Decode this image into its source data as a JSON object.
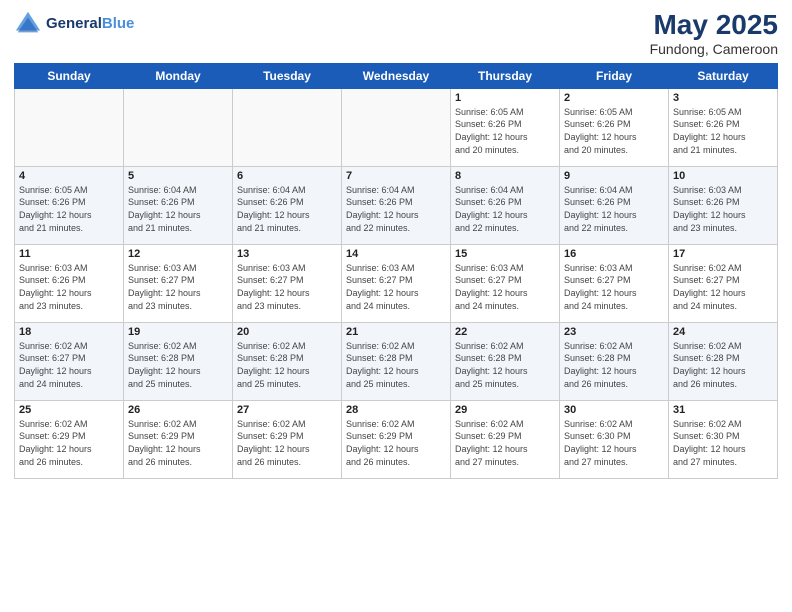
{
  "header": {
    "logo_line1": "General",
    "logo_line2": "Blue",
    "main_title": "May 2025",
    "subtitle": "Fundong, Cameroon"
  },
  "days_of_week": [
    "Sunday",
    "Monday",
    "Tuesday",
    "Wednesday",
    "Thursday",
    "Friday",
    "Saturday"
  ],
  "weeks": [
    [
      {
        "day": "",
        "info": ""
      },
      {
        "day": "",
        "info": ""
      },
      {
        "day": "",
        "info": ""
      },
      {
        "day": "",
        "info": ""
      },
      {
        "day": "1",
        "info": "Sunrise: 6:05 AM\nSunset: 6:26 PM\nDaylight: 12 hours\nand 20 minutes."
      },
      {
        "day": "2",
        "info": "Sunrise: 6:05 AM\nSunset: 6:26 PM\nDaylight: 12 hours\nand 20 minutes."
      },
      {
        "day": "3",
        "info": "Sunrise: 6:05 AM\nSunset: 6:26 PM\nDaylight: 12 hours\nand 21 minutes."
      }
    ],
    [
      {
        "day": "4",
        "info": "Sunrise: 6:05 AM\nSunset: 6:26 PM\nDaylight: 12 hours\nand 21 minutes."
      },
      {
        "day": "5",
        "info": "Sunrise: 6:04 AM\nSunset: 6:26 PM\nDaylight: 12 hours\nand 21 minutes."
      },
      {
        "day": "6",
        "info": "Sunrise: 6:04 AM\nSunset: 6:26 PM\nDaylight: 12 hours\nand 21 minutes."
      },
      {
        "day": "7",
        "info": "Sunrise: 6:04 AM\nSunset: 6:26 PM\nDaylight: 12 hours\nand 22 minutes."
      },
      {
        "day": "8",
        "info": "Sunrise: 6:04 AM\nSunset: 6:26 PM\nDaylight: 12 hours\nand 22 minutes."
      },
      {
        "day": "9",
        "info": "Sunrise: 6:04 AM\nSunset: 6:26 PM\nDaylight: 12 hours\nand 22 minutes."
      },
      {
        "day": "10",
        "info": "Sunrise: 6:03 AM\nSunset: 6:26 PM\nDaylight: 12 hours\nand 23 minutes."
      }
    ],
    [
      {
        "day": "11",
        "info": "Sunrise: 6:03 AM\nSunset: 6:26 PM\nDaylight: 12 hours\nand 23 minutes."
      },
      {
        "day": "12",
        "info": "Sunrise: 6:03 AM\nSunset: 6:27 PM\nDaylight: 12 hours\nand 23 minutes."
      },
      {
        "day": "13",
        "info": "Sunrise: 6:03 AM\nSunset: 6:27 PM\nDaylight: 12 hours\nand 23 minutes."
      },
      {
        "day": "14",
        "info": "Sunrise: 6:03 AM\nSunset: 6:27 PM\nDaylight: 12 hours\nand 24 minutes."
      },
      {
        "day": "15",
        "info": "Sunrise: 6:03 AM\nSunset: 6:27 PM\nDaylight: 12 hours\nand 24 minutes."
      },
      {
        "day": "16",
        "info": "Sunrise: 6:03 AM\nSunset: 6:27 PM\nDaylight: 12 hours\nand 24 minutes."
      },
      {
        "day": "17",
        "info": "Sunrise: 6:02 AM\nSunset: 6:27 PM\nDaylight: 12 hours\nand 24 minutes."
      }
    ],
    [
      {
        "day": "18",
        "info": "Sunrise: 6:02 AM\nSunset: 6:27 PM\nDaylight: 12 hours\nand 24 minutes."
      },
      {
        "day": "19",
        "info": "Sunrise: 6:02 AM\nSunset: 6:28 PM\nDaylight: 12 hours\nand 25 minutes."
      },
      {
        "day": "20",
        "info": "Sunrise: 6:02 AM\nSunset: 6:28 PM\nDaylight: 12 hours\nand 25 minutes."
      },
      {
        "day": "21",
        "info": "Sunrise: 6:02 AM\nSunset: 6:28 PM\nDaylight: 12 hours\nand 25 minutes."
      },
      {
        "day": "22",
        "info": "Sunrise: 6:02 AM\nSunset: 6:28 PM\nDaylight: 12 hours\nand 25 minutes."
      },
      {
        "day": "23",
        "info": "Sunrise: 6:02 AM\nSunset: 6:28 PM\nDaylight: 12 hours\nand 26 minutes."
      },
      {
        "day": "24",
        "info": "Sunrise: 6:02 AM\nSunset: 6:28 PM\nDaylight: 12 hours\nand 26 minutes."
      }
    ],
    [
      {
        "day": "25",
        "info": "Sunrise: 6:02 AM\nSunset: 6:29 PM\nDaylight: 12 hours\nand 26 minutes."
      },
      {
        "day": "26",
        "info": "Sunrise: 6:02 AM\nSunset: 6:29 PM\nDaylight: 12 hours\nand 26 minutes."
      },
      {
        "day": "27",
        "info": "Sunrise: 6:02 AM\nSunset: 6:29 PM\nDaylight: 12 hours\nand 26 minutes."
      },
      {
        "day": "28",
        "info": "Sunrise: 6:02 AM\nSunset: 6:29 PM\nDaylight: 12 hours\nand 26 minutes."
      },
      {
        "day": "29",
        "info": "Sunrise: 6:02 AM\nSunset: 6:29 PM\nDaylight: 12 hours\nand 27 minutes."
      },
      {
        "day": "30",
        "info": "Sunrise: 6:02 AM\nSunset: 6:30 PM\nDaylight: 12 hours\nand 27 minutes."
      },
      {
        "day": "31",
        "info": "Sunrise: 6:02 AM\nSunset: 6:30 PM\nDaylight: 12 hours\nand 27 minutes."
      }
    ]
  ]
}
